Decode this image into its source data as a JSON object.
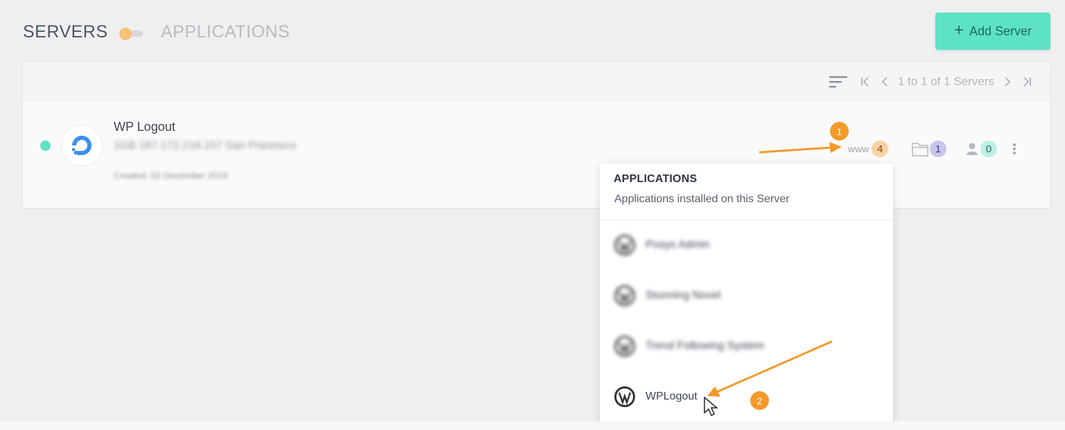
{
  "header": {
    "servers_label": "SERVERS",
    "applications_label": "APPLICATIONS",
    "add_server_label": "Add Server"
  },
  "toolbar": {
    "pagination_text": "1 to 1 of 1 Servers"
  },
  "server": {
    "name": "WP Logout",
    "detail": "1GB 167.172.218.157 San Francisco",
    "created": "Created: 02 December 2019",
    "status": "online",
    "stats": {
      "www_label": "www",
      "apps_count": "4",
      "folders_count": "1",
      "users_count": "0"
    }
  },
  "applications_dropdown": {
    "title": "APPLICATIONS",
    "subtitle": "Applications installed on this Server",
    "items": [
      {
        "label": "Posys Admin",
        "blurred": true
      },
      {
        "label": "Stunning Novel",
        "blurred": true
      },
      {
        "label": "Trend Following System",
        "blurred": true
      },
      {
        "label": "WPLogout",
        "blurred": false
      }
    ]
  },
  "annotations": {
    "step1": "1",
    "step2": "2"
  },
  "colors": {
    "accent_teal": "#5de2c4",
    "annotation_orange": "#f39a2b",
    "toggle_knob": "#f7c178"
  }
}
